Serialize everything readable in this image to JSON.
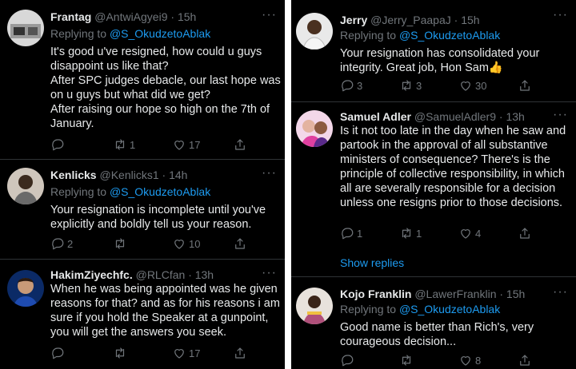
{
  "left_column": [
    {
      "name": "Frantag",
      "handle": "@AntwiAgyei9",
      "time": "· 15h",
      "replying_prefix": "Replying to",
      "replying_to": "@S_OkudzetoAblak",
      "text": "It's good u've resigned, how could u guys disappoint us like that?\nAfter SPC judges debacle, our last hope was on u guys but what did we get?\nAfter raising our hope so high on the 7th of January.",
      "replies": "",
      "retweets": "1",
      "likes": "17"
    },
    {
      "name": "Kenlicks",
      "handle": "@Kenlicks1",
      "time": "· 14h",
      "replying_prefix": "Replying to",
      "replying_to": "@S_OkudzetoAblak",
      "text": "Your resignation is incomplete until you've explicitly and boldly tell us your reason.",
      "replies": "2",
      "retweets": "",
      "likes": "10"
    },
    {
      "name": "HakimZiyechfc.",
      "handle": "@RLCfan",
      "time": "· 13h",
      "text": "When he was being appointed was he given reasons for that? and as for his reasons i am sure if you hold the Speaker at a gunpoint, you will get the answers you seek.",
      "replies": "",
      "retweets": "",
      "likes": "17"
    }
  ],
  "right_column": [
    {
      "name": "Jerry",
      "handle": "@Jerry_PaapaJ",
      "time": "· 15h",
      "replying_prefix": "Replying to",
      "replying_to": "@S_OkudzetoAblak",
      "text": "Your resignation has consolidated your integrity.  Great job,  Hon Sam👍",
      "replies": "3",
      "retweets": "3",
      "likes": "30"
    },
    {
      "name": "Samuel Adler",
      "handle": "@SamuelAdler9",
      "time": "· 13h",
      "text": "Is it not too late in the day when he saw and partook in the approval of all substantive ministers of consequence? There's is the principle of collective responsibility, in which all are severally responsible for a decision unless one resigns prior to those decisions.",
      "replies": "1",
      "retweets": "1",
      "likes": "4",
      "show_replies": "Show replies"
    },
    {
      "name": "Kojo Franklin",
      "handle": "@LawerFranklin",
      "time": "· 15h",
      "replying_prefix": "Replying to",
      "replying_to": "@S_OkudzetoAblak",
      "text": "Good name is better than Rich's, very courageous decision...",
      "replies": "",
      "retweets": "",
      "likes": "8"
    }
  ],
  "more_glyph": "···"
}
